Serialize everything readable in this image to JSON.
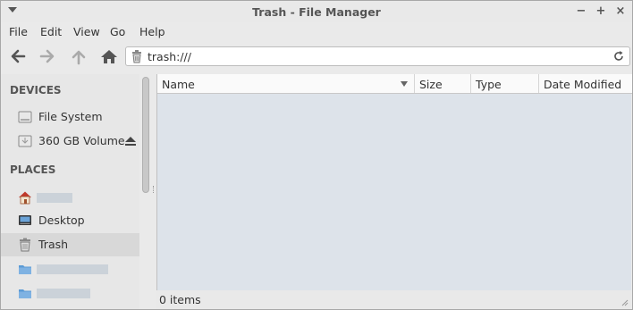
{
  "window": {
    "title": "Trash - File Manager",
    "controls": {
      "minimize": "−",
      "maximize": "+",
      "close": "×"
    }
  },
  "menubar": {
    "items": [
      "File",
      "Edit",
      "View",
      "Go",
      "Help"
    ]
  },
  "toolbar": {
    "icons": [
      "back-arrow-icon",
      "forward-arrow-icon",
      "up-arrow-icon",
      "home-icon"
    ],
    "address": "trash:///",
    "address_icon": "trash-icon",
    "reload_icon": "reload-icon"
  },
  "sidebar": {
    "devices_heading": "DEVICES",
    "devices": [
      {
        "label": "File System",
        "icon": "drive-icon"
      },
      {
        "label": "360 GB Volume",
        "icon": "removable-drive-icon",
        "eject_icon": "eject-icon"
      }
    ],
    "places_heading": "PLACES",
    "places": [
      {
        "label": "",
        "icon": "home-icon"
      },
      {
        "label": "Desktop",
        "icon": "desktop-icon"
      },
      {
        "label": "Trash",
        "icon": "trash-icon",
        "active": true
      },
      {
        "label": "",
        "icon": "folder-icon"
      },
      {
        "label": "",
        "icon": "folder-icon"
      }
    ]
  },
  "fileview": {
    "columns": [
      "Name",
      "Size",
      "Type",
      "Date Modified"
    ],
    "sort_column": "Name",
    "rows": []
  },
  "status": {
    "text": "0 items"
  },
  "colors": {
    "folder": "#5b9bd5",
    "home_roof": "#c0392b",
    "selection": "#d8d8d8"
  }
}
